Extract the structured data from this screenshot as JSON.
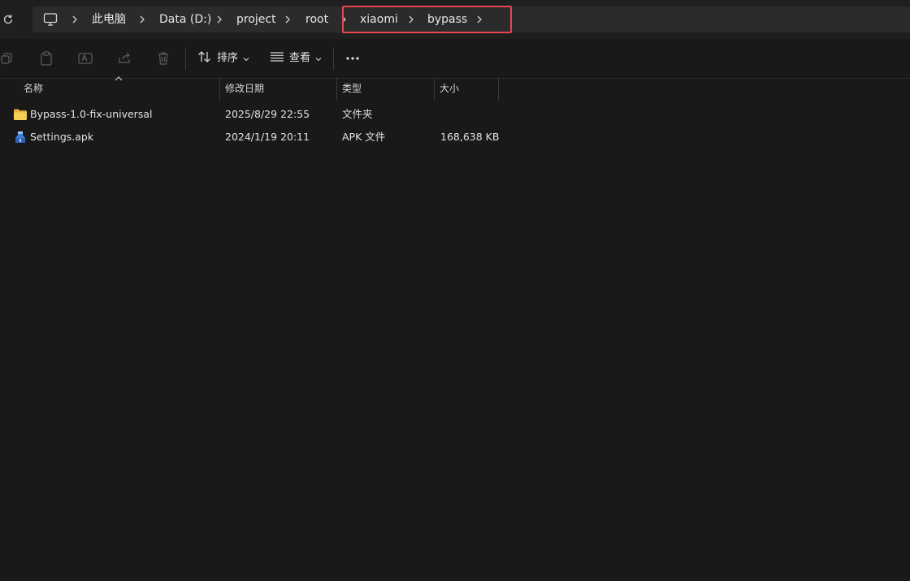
{
  "breadcrumbs": [
    {
      "label": "此电脑"
    },
    {
      "label": "Data (D:)"
    },
    {
      "label": "project"
    },
    {
      "label": "root"
    },
    {
      "label": "xiaomi"
    },
    {
      "label": "bypass"
    }
  ],
  "toolbar": {
    "sort_label": "排序",
    "view_label": "查看",
    "more_label": "···"
  },
  "columns": {
    "name": "名称",
    "modified": "修改日期",
    "type": "类型",
    "size": "大小"
  },
  "files": [
    {
      "name": "Bypass-1.0-fix-universal",
      "modified": "2025/8/29 22:55",
      "type": "文件夹",
      "size": "",
      "icon": "folder-icon"
    },
    {
      "name": "Settings.apk",
      "modified": "2024/1/19 20:11",
      "type": "APK 文件",
      "size": "168,638 KB",
      "icon": "apk-file-icon"
    }
  ],
  "colors": {
    "background": "#191919",
    "highlight": "#e5484d",
    "folder": "#f4c542"
  }
}
